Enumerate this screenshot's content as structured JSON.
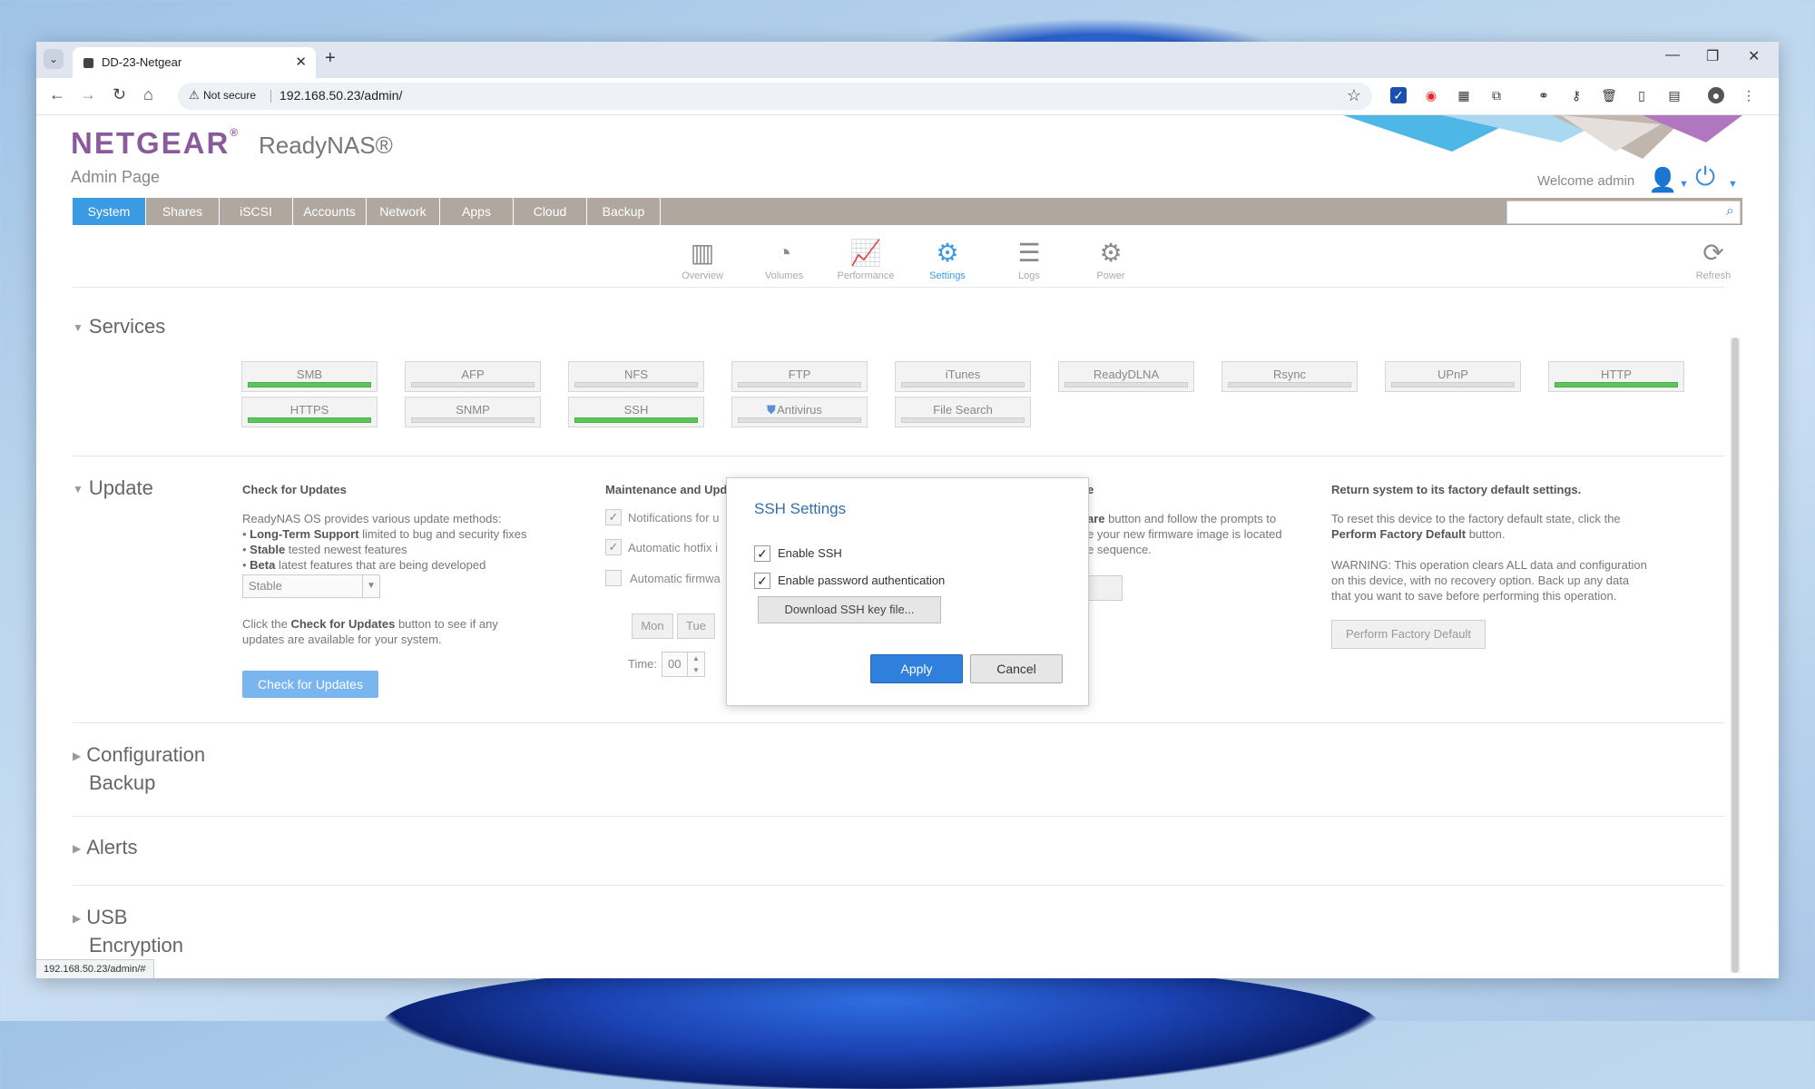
{
  "browser": {
    "tab_title": "DD-23-Netgear",
    "security_label": "Not secure",
    "url": "192.168.50.23/admin/",
    "status_url": "192.168.50.23/admin/#"
  },
  "header": {
    "brand": "NETGEAR",
    "brand_mark": "®",
    "product": "ReadyNAS®",
    "subtitle": "Admin Page",
    "welcome": "Welcome admin"
  },
  "menu": {
    "items": [
      "System",
      "Shares",
      "iSCSI",
      "Accounts",
      "Network",
      "Apps",
      "Cloud",
      "Backup"
    ],
    "active": "System",
    "search_placeholder": ""
  },
  "subnav": {
    "items": [
      "Overview",
      "Volumes",
      "Performance",
      "Settings",
      "Logs",
      "Power"
    ],
    "active": "Settings",
    "refresh": "Refresh"
  },
  "services": {
    "title": "Services",
    "row1": [
      {
        "label": "SMB",
        "enabled": true
      },
      {
        "label": "AFP",
        "enabled": false
      },
      {
        "label": "NFS",
        "enabled": false
      },
      {
        "label": "FTP",
        "enabled": false
      },
      {
        "label": "iTunes",
        "enabled": false
      },
      {
        "label": "ReadyDLNA",
        "enabled": false
      },
      {
        "label": "Rsync",
        "enabled": false
      },
      {
        "label": "UPnP",
        "enabled": false
      },
      {
        "label": "HTTP",
        "enabled": true
      }
    ],
    "row2": [
      {
        "label": "HTTPS",
        "enabled": true
      },
      {
        "label": "SNMP",
        "enabled": false
      },
      {
        "label": "SSH",
        "enabled": true
      },
      {
        "label": "Antivirus",
        "enabled": false
      },
      {
        "label": "File Search",
        "enabled": false
      }
    ]
  },
  "update": {
    "title": "Update",
    "check": {
      "heading": "Check for Updates",
      "intro": "ReadyNAS OS provides various update methods:",
      "bullet1_bold": "Long-Term Support",
      "bullet1_rest": " limited to bug and security fixes",
      "bullet2_bold": "Stable",
      "bullet2_rest": " tested newest features",
      "bullet3_bold": "Beta",
      "bullet3_rest": " latest features that are being developed",
      "select_value": "Stable",
      "help_pre": "Click the ",
      "help_bold": "Check for Updates",
      "help_post": " button to see if any",
      "help_line2": "updates are available for your system.",
      "button": "Check for Updates"
    },
    "maintenance": {
      "heading": "Maintenance and Upda",
      "opt1": "Notifications for u",
      "opt2": "Automatic hotfix i",
      "opt3": "Automatic firmwa",
      "day_mon": "Mon",
      "day_tue": "Tue",
      "time_label": "Time:",
      "time_value": "00"
    },
    "firmware": {
      "heading_tail": "e",
      "line1_bold": "are",
      "line1_rest": " button and follow the prompts to",
      "line2": "e your new firmware image is located",
      "line3": "e sequence."
    },
    "factory": {
      "heading": "Return system to its factory default settings.",
      "line1": "To reset this device to the factory default state, click the",
      "line2_bold": "Perform Factory Default",
      "line2_rest": " button.",
      "warn1": "WARNING: This operation clears ALL data and configuration",
      "warn2": "on this device, with no recovery option. Back up any data",
      "warn3": "that you want to save before performing this operation.",
      "button": "Perform Factory Default"
    }
  },
  "sections": {
    "config_backup_1": "Configuration",
    "config_backup_2": "Backup",
    "alerts": "Alerts",
    "usb_1": "USB",
    "usb_2": "Encryption"
  },
  "modal": {
    "title": "SSH Settings",
    "enable_ssh": "Enable SSH",
    "enable_ssh_checked": true,
    "enable_pw": "Enable password authentication",
    "enable_pw_checked": true,
    "download": "Download SSH key file...",
    "apply": "Apply",
    "cancel": "Cancel"
  },
  "colors": {
    "accent": "#3a9be2",
    "brand": "#8a5b9c",
    "service_on": "#5cc55c",
    "apply": "#2f7fdc"
  }
}
